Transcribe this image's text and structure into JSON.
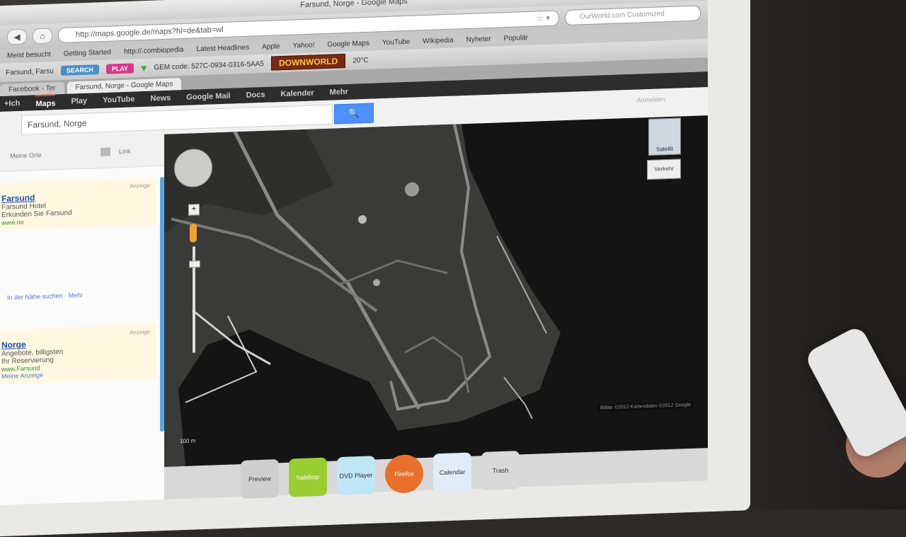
{
  "window": {
    "title": "Farsund, Norge - Google Maps"
  },
  "browser": {
    "url": "http://maps.google.de/maps?hl=de&tab=wl",
    "search_placeholder": "OurWorld.com Customized"
  },
  "bookmarks": [
    "Meist besucht",
    "Getting Started",
    "http://.combiopedia",
    "Latest Headlines",
    "Apple",
    "Yahoo!",
    "Google Maps",
    "YouTube",
    "Wikipedia",
    "Nyheter",
    "Populär"
  ],
  "toolbar": {
    "location": "Farsund, Farsu",
    "chip1": "SEARCH",
    "chip2": "PLAY",
    "gem_code": "GEM code: 527C-0934-0316-5AA5",
    "brand": "DOWNWORLD",
    "temp": "20°C"
  },
  "tabs": [
    {
      "label": "Facebook - Ter"
    },
    {
      "label": "Farsund, Norge - Google Maps"
    }
  ],
  "google_bar": {
    "items": [
      "+Ich",
      "Maps",
      "Play",
      "YouTube",
      "News",
      "Google Mail",
      "Docs",
      "Kalender",
      "Mehr"
    ],
    "selected": "Maps"
  },
  "search": {
    "query": "Farsund, Norge",
    "button_icon": "search-icon",
    "sign_in": "Anmelden"
  },
  "sidebar": {
    "my_maps": "Meine Orte",
    "link": "Link",
    "ad1": {
      "label": "Anzeige",
      "title": "Farsund",
      "desc": "Farsund Hotel",
      "desc2": "Erkunden Sie Farsund",
      "url": "www.no"
    },
    "more_link1": "In der Nähe suchen · Mehr",
    "ad2": {
      "label": "Anzeige",
      "title": "Norge",
      "desc": "Angebote, billigsten",
      "desc2": "Ihr Reservierung",
      "url": "www.Farsund"
    },
    "more_link2": "Meine Anzeige"
  },
  "map": {
    "zoom_in": "+",
    "type_satellite": "Satellit",
    "type_traffic": "Verkehr",
    "scale": "100 m",
    "copyright": "Bilder ©2012 Kartendaten ©2012 Google",
    "image_label": "Bilder"
  },
  "dock": [
    "Preview",
    "halebop",
    "DVD Player",
    "Firefox",
    "Calendar",
    "Trash"
  ],
  "colors": {
    "accent": "#4d90fe",
    "map_bg": "#141414",
    "gbar": "#2d2d2d"
  }
}
